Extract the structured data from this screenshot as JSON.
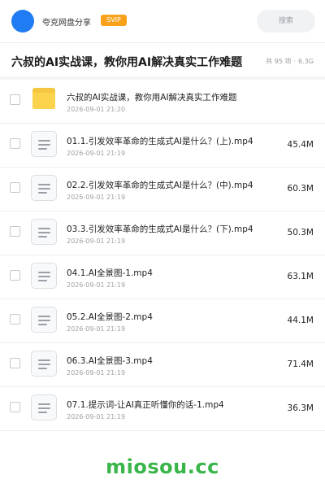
{
  "header": {
    "owner_name": "夸克网盘分享",
    "badge": "SVIP",
    "search_label": "搜索"
  },
  "share": {
    "title": "六叔的AI实战课，教你用AI解决真实工作难题",
    "count": "共 95 项",
    "separator": "·",
    "total_size": "6.3G"
  },
  "files": [
    {
      "type": "folder",
      "name": "六叔的AI实战课，教你用AI解决真实工作难题",
      "date": "2026-09-01 21:20",
      "size": ""
    },
    {
      "type": "file",
      "name": "01.1.引发效率革命的生成式AI是什么？(上).mp4",
      "date": "2026-09-01 21:19",
      "size": "45.4M"
    },
    {
      "type": "file",
      "name": "02.2.引发效率革命的生成式AI是什么？(中).mp4",
      "date": "2026-09-01 21:19",
      "size": "60.3M"
    },
    {
      "type": "file",
      "name": "03.3.引发效率革命的生成式AI是什么？(下).mp4",
      "date": "2026-09-01 21:19",
      "size": "50.3M"
    },
    {
      "type": "file",
      "name": "04.1.AI全景图-1.mp4",
      "date": "2026-09-01 21:19",
      "size": "63.1M"
    },
    {
      "type": "file",
      "name": "05.2.AI全景图-2.mp4",
      "date": "2026-09-01 21:19",
      "size": "44.1M"
    },
    {
      "type": "file",
      "name": "06.3.AI全景图-3.mp4",
      "date": "2026-09-01 21:19",
      "size": "71.4M"
    },
    {
      "type": "file",
      "name": "07.1.提示词-让AI真正听懂你的话-1.mp4",
      "date": "2026-09-01 21:19",
      "size": "36.3M"
    }
  ],
  "footer": {
    "watermark": "miosou.cc"
  },
  "colors": {
    "accent": "#1f7cf2",
    "badge": "#f7a21a",
    "folder": "#fcd34d",
    "watermark": "#3ab54a"
  }
}
